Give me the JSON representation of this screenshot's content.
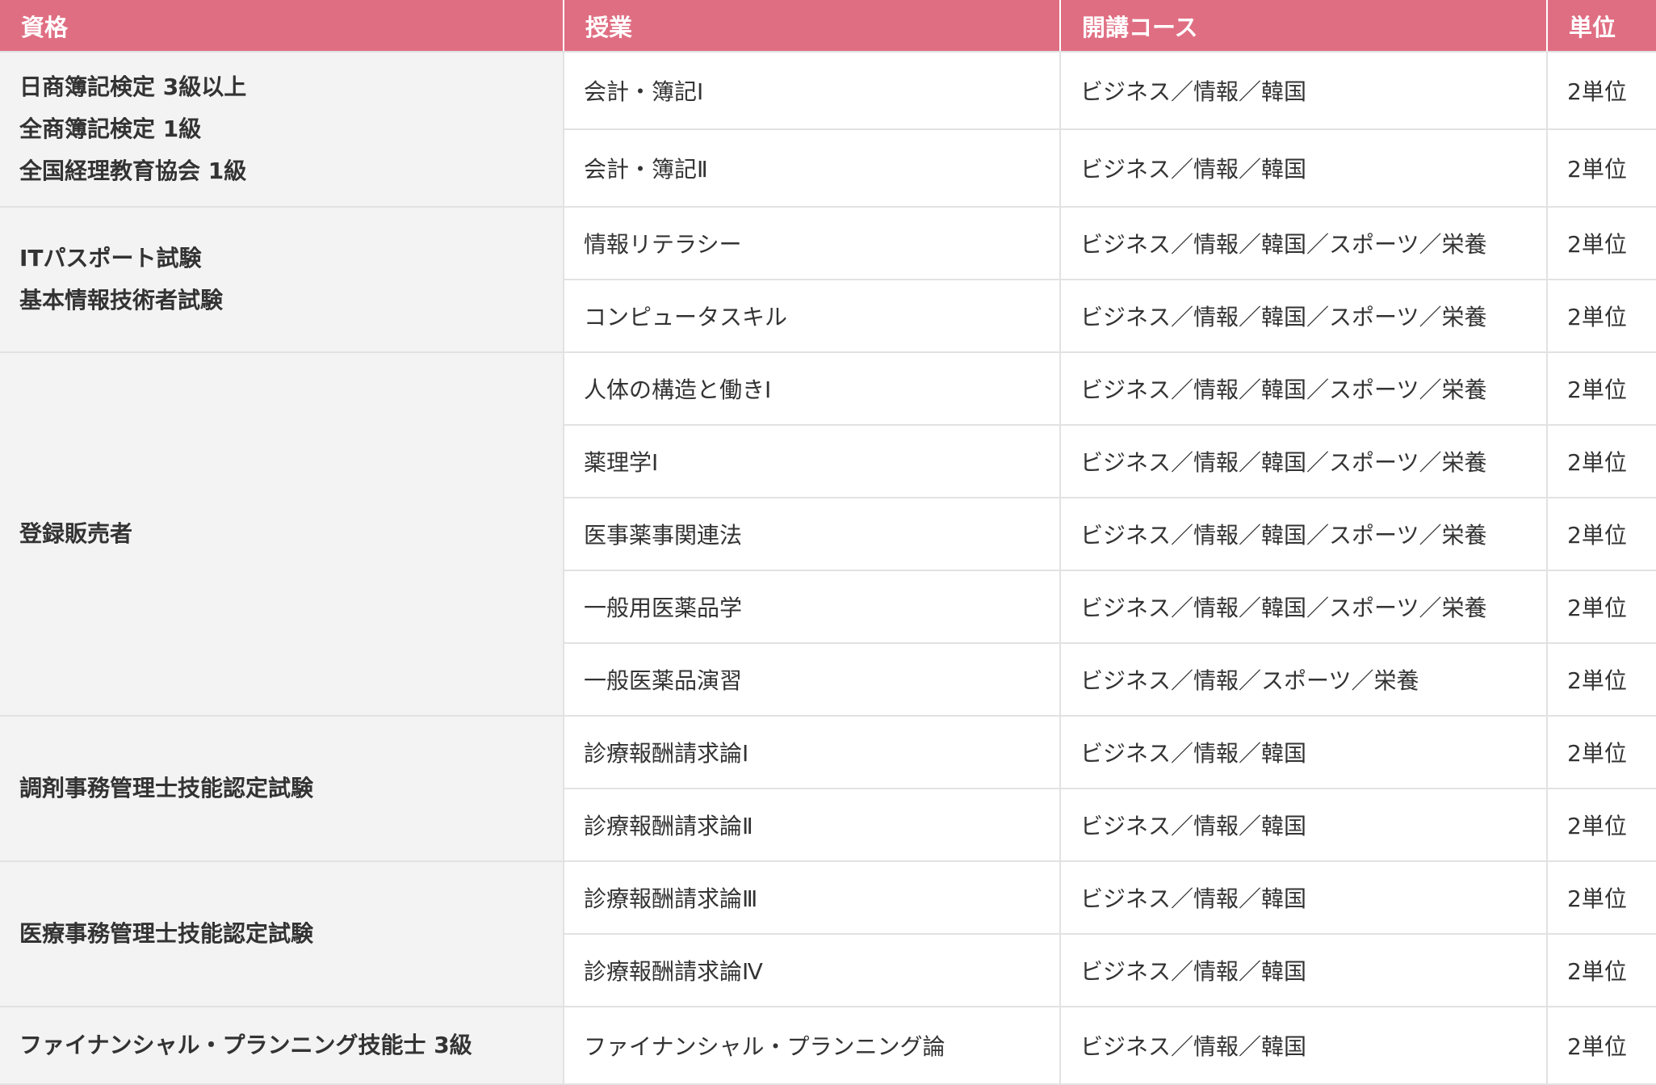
{
  "headers": {
    "qualification": "資格",
    "class": "授業",
    "course": "開講コース",
    "unit": "単位"
  },
  "colors": {
    "header_bg": "#e06e82",
    "qualification_bg": "#f3f3f3",
    "border": "#e2e2e2"
  },
  "groups": [
    {
      "qualification": [
        "日商簿記検定 3級以上",
        "全商簿記検定 1級",
        "全国経理教育協会 1級"
      ],
      "rows": [
        {
          "class": "会計・簿記Ⅰ",
          "course": "ビジネス／情報／韓国",
          "unit": "2単位"
        },
        {
          "class": "会計・簿記Ⅱ",
          "course": "ビジネス／情報／韓国",
          "unit": "2単位"
        }
      ]
    },
    {
      "qualification": [
        "ITパスポート試験",
        "基本情報技術者試験"
      ],
      "rows": [
        {
          "class": "情報リテラシー",
          "course": "ビジネス／情報／韓国／スポーツ／栄養",
          "unit": "2単位"
        },
        {
          "class": "コンピュータスキル",
          "course": "ビジネス／情報／韓国／スポーツ／栄養",
          "unit": "2単位"
        }
      ]
    },
    {
      "qualification": [
        "登録販売者"
      ],
      "rows": [
        {
          "class": "人体の構造と働きⅠ",
          "course": "ビジネス／情報／韓国／スポーツ／栄養",
          "unit": "2単位"
        },
        {
          "class": "薬理学Ⅰ",
          "course": "ビジネス／情報／韓国／スポーツ／栄養",
          "unit": "2単位"
        },
        {
          "class": "医事薬事関連法",
          "course": "ビジネス／情報／韓国／スポーツ／栄養",
          "unit": "2単位"
        },
        {
          "class": "一般用医薬品学",
          "course": "ビジネス／情報／韓国／スポーツ／栄養",
          "unit": "2単位"
        },
        {
          "class": "一般医薬品演習",
          "course": "ビジネス／情報／スポーツ／栄養",
          "unit": "2単位"
        }
      ]
    },
    {
      "qualification": [
        "調剤事務管理士技能認定試験"
      ],
      "rows": [
        {
          "class": "診療報酬請求論Ⅰ",
          "course": "ビジネス／情報／韓国",
          "unit": "2単位"
        },
        {
          "class": "診療報酬請求論Ⅱ",
          "course": "ビジネス／情報／韓国",
          "unit": "2単位"
        }
      ]
    },
    {
      "qualification": [
        "医療事務管理士技能認定試験"
      ],
      "rows": [
        {
          "class": "診療報酬請求論Ⅲ",
          "course": "ビジネス／情報／韓国",
          "unit": "2単位"
        },
        {
          "class": "診療報酬請求論Ⅳ",
          "course": "ビジネス／情報／韓国",
          "unit": "2単位"
        }
      ]
    },
    {
      "qualification": [
        "ファイナンシャル・プランニング技能士 3級"
      ],
      "rows": [
        {
          "class": "ファイナンシャル・プランニング論",
          "course": "ビジネス／情報／韓国",
          "unit": "2単位"
        }
      ]
    }
  ]
}
